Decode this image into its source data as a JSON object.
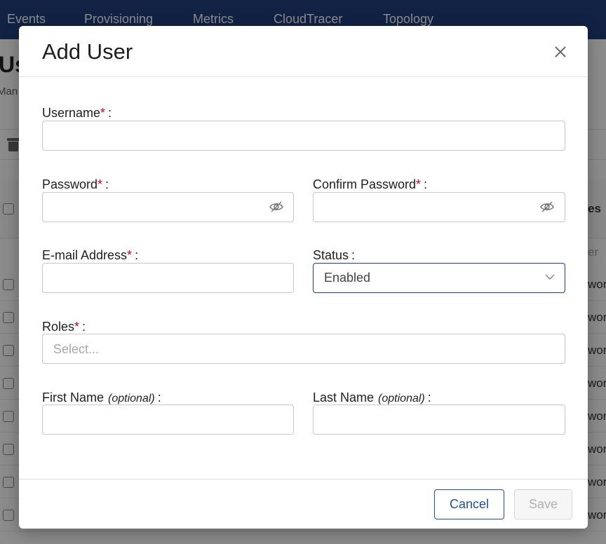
{
  "topnav": {
    "items": [
      "Events",
      "Provisioning",
      "Metrics",
      "CloudTracer",
      "Topology"
    ]
  },
  "background": {
    "page_title_fragment": "Us",
    "subtitle_fragment": "Man",
    "column_header_fragment": "es",
    "column_filter_fragment": "er",
    "row_fragments": [
      "wor",
      "wor",
      "wor",
      "wor",
      "wor",
      "wor",
      "wor",
      "wor"
    ]
  },
  "modal": {
    "title": "Add User",
    "close_icon": "close-icon",
    "fields": {
      "username": {
        "label": "Username",
        "value": "",
        "required": true
      },
      "password": {
        "label": "Password",
        "value": "",
        "required": true,
        "icon": "eye-slash-icon"
      },
      "confirm_password": {
        "label": "Confirm Password",
        "value": "",
        "required": true,
        "icon": "eye-slash-icon"
      },
      "email": {
        "label": "E-mail Address",
        "value": "",
        "required": true
      },
      "status": {
        "label": "Status",
        "selected": "Enabled",
        "icon": "chevron-down-icon"
      },
      "roles": {
        "label": "Roles",
        "placeholder": "Select...",
        "required": true
      },
      "first_name": {
        "label": "First Name",
        "optional_text": "(optional)",
        "value": ""
      },
      "last_name": {
        "label": "Last Name",
        "optional_text": "(optional)",
        "value": ""
      }
    },
    "required_marker": "*",
    "label_suffix": ":",
    "buttons": {
      "cancel": "Cancel",
      "save": "Save"
    }
  },
  "colors": {
    "nav_background": "#1f3f7f",
    "required_marker": "#d0021b",
    "primary": "#1f4f9f",
    "disabled_text": "#b0b0b0"
  }
}
